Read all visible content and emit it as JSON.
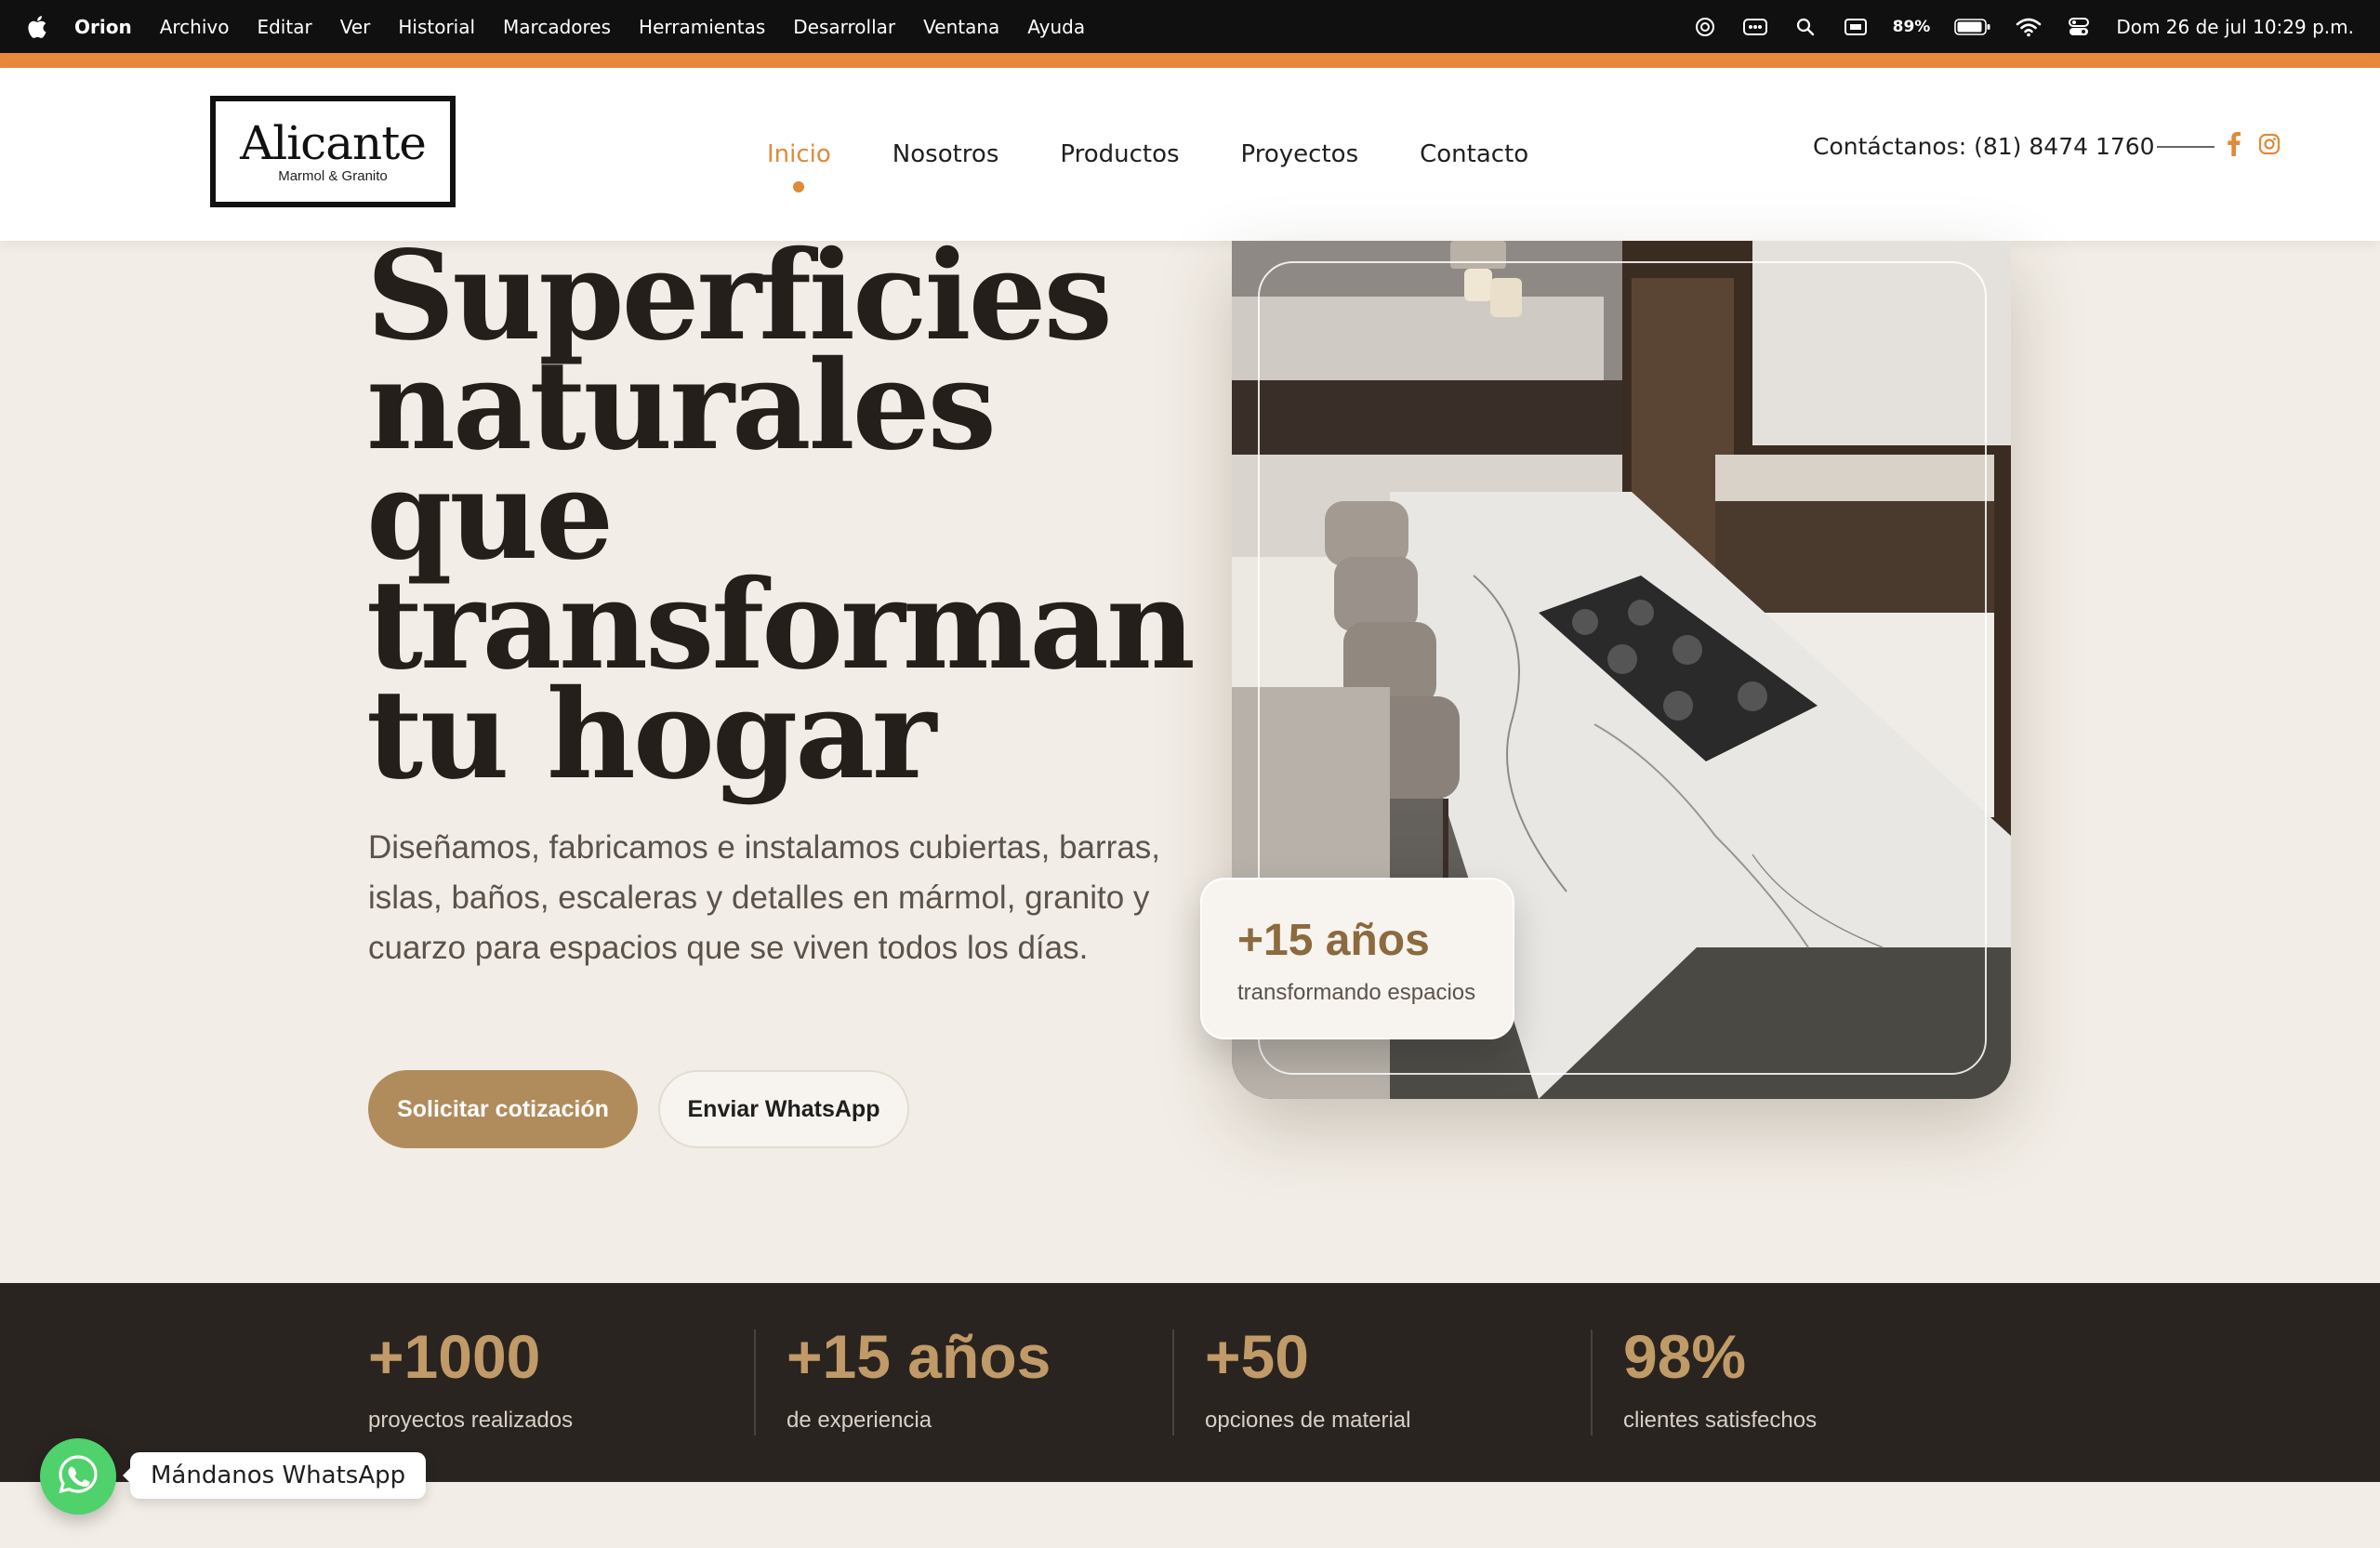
{
  "menubar": {
    "app_name": "Orion",
    "items": [
      "Archivo",
      "Editar",
      "Ver",
      "Historial",
      "Marcadores",
      "Herramientas",
      "Desarrollar",
      "Ventana",
      "Ayuda"
    ],
    "battery": "89%",
    "clock": "Dom 26 de jul  10:29 p.m."
  },
  "header": {
    "logo_name": "Alicante",
    "logo_sub": "Marmol & Granito",
    "nav": [
      "Inicio",
      "Nosotros",
      "Productos",
      "Proyectos",
      "Contacto"
    ],
    "active_nav": "Inicio",
    "contact": "Contáctanos: (81) 8474 1760",
    "accent_color": "#e08a3a"
  },
  "hero": {
    "title_lines": [
      "Superficies",
      "naturales",
      "que",
      "transforman",
      "tu hogar"
    ],
    "description": "Diseñamos, fabricamos e instalamos cubiertas, barras, islas, baños, escaleras y detalles en mármol, granito y cuarzo para espacios que se viven todos los días.",
    "primary_button": "Solicitar cotización",
    "secondary_button": "Enviar WhatsApp",
    "badge_value": "+15 años",
    "badge_label": "transformando espacios"
  },
  "stats": [
    {
      "value": "+1000",
      "label": "proyectos realizados"
    },
    {
      "value": "+15 años",
      "label": "de experiencia"
    },
    {
      "value": "+50",
      "label": "opciones de material"
    },
    {
      "value": "98%",
      "label": "clientes satisfechos"
    }
  ],
  "whatsapp": {
    "label": "Mándanos WhatsApp"
  }
}
